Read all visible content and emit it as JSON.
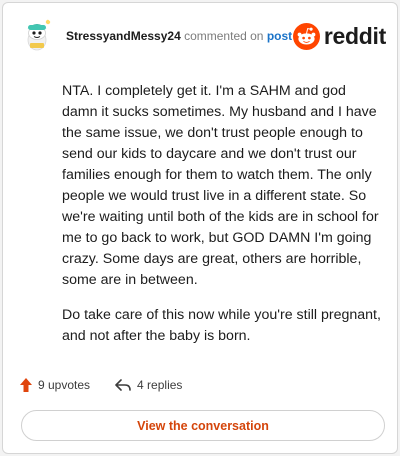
{
  "comment": {
    "username": "StressyandMessy24",
    "commented_on_text": "commented on",
    "post_link": "post",
    "brand": "reddit",
    "paragraphs": [
      "NTA. I completely get it. I'm a SAHM and god damn it sucks sometimes. My husband and I have the same issue, we don't trust people enough to send our kids to daycare and we don't trust our families enough for them to watch them. The only people we would trust live in a different state. So we're waiting until both of the kids are in school for me to go back to work, but GOD DAMN I'm going crazy. Some days are great, others are horrible, some are in between.",
      "Do take care of this now while you're still pregnant, and not after the baby is born."
    ],
    "upvotes_label": "9 upvotes",
    "replies_label": "4 replies",
    "view_button_label": "View the conversation"
  },
  "colors": {
    "reddit_orange": "#ff4500",
    "upvote_orange": "#e0450d",
    "link_blue": "#1a73c8",
    "button_text": "#d4450b"
  },
  "icons": {
    "avatar": "snoo-avatar-icon",
    "brand_logo": "reddit-logo-icon",
    "upvote": "upvote-arrow-icon",
    "reply": "reply-arrow-icon"
  }
}
